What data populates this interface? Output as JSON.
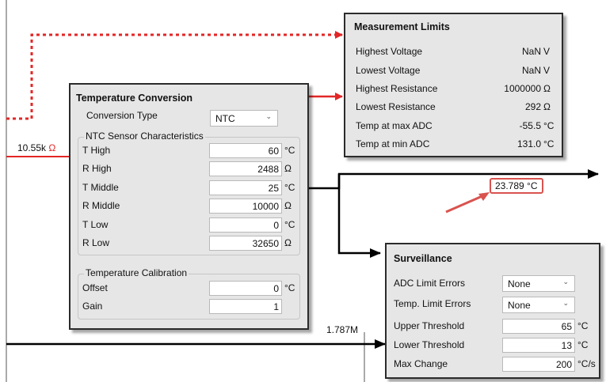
{
  "wires": {
    "input_resistance": "10.55k",
    "ohm_symbol": "Ω",
    "adc_value": "1.787M",
    "temperature_readout": "23.789 °C",
    "colors": {
      "active": "#e32626",
      "normal": "#000000",
      "readout_border": "#d9534f"
    }
  },
  "measurement_limits": {
    "title": "Measurement Limits",
    "rows": [
      {
        "label": "Highest Voltage",
        "value": "NaN",
        "unit": "V"
      },
      {
        "label": "Lowest Voltage",
        "value": "NaN",
        "unit": "V"
      },
      {
        "label": "Highest Resistance",
        "value": "1000000",
        "unit": "Ω"
      },
      {
        "label": "Lowest Resistance",
        "value": "292",
        "unit": "Ω"
      },
      {
        "label": "Temp at max ADC",
        "value": "-55.5",
        "unit": "°C"
      },
      {
        "label": "Temp at min ADC",
        "value": "131.0",
        "unit": "°C"
      }
    ]
  },
  "temperature_conversion": {
    "title": "Temperature Conversion",
    "conversion_type_label": "Conversion Type",
    "conversion_type_value": "NTC",
    "ntc_group_label": "NTC Sensor Characteristics",
    "ntc_rows": [
      {
        "label": "T High",
        "value": "60",
        "unit": "°C"
      },
      {
        "label": "R High",
        "value": "2488",
        "unit": "Ω"
      },
      {
        "label": "T Middle",
        "value": "25",
        "unit": "°C"
      },
      {
        "label": "R Middle",
        "value": "10000",
        "unit": "Ω"
      },
      {
        "label": "T Low",
        "value": "0",
        "unit": "°C"
      },
      {
        "label": "R Low",
        "value": "32650",
        "unit": "Ω"
      }
    ],
    "calibration_group_label": "Temperature Calibration",
    "calibration_rows": [
      {
        "label": "Offset",
        "value": "0",
        "unit": "°C"
      },
      {
        "label": "Gain",
        "value": "1",
        "unit": ""
      }
    ]
  },
  "surveillance": {
    "title": "Surveillance",
    "adc_limit_label": "ADC Limit Errors",
    "adc_limit_value": "None",
    "temp_limit_label": "Temp. Limit Errors",
    "temp_limit_value": "None",
    "rows": [
      {
        "label": "Upper Threshold",
        "value": "65",
        "unit": "°C"
      },
      {
        "label": "Lower Threshold",
        "value": "13",
        "unit": "°C"
      },
      {
        "label": "Max Change",
        "value": "200",
        "unit": "°C/s"
      }
    ]
  }
}
